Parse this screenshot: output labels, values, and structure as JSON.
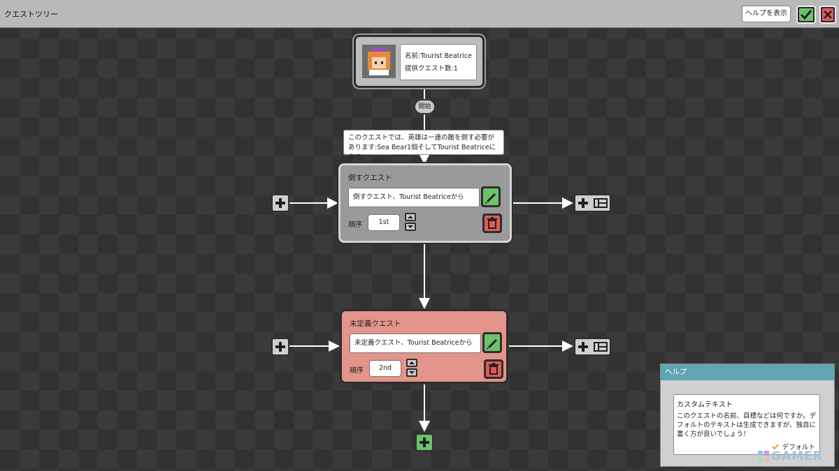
{
  "window": {
    "title": "クエストツリー"
  },
  "toolbar": {
    "help_label": "ヘルプを表示"
  },
  "giver": {
    "name_line": "名前:Tourist Beatrice",
    "count_line": "提供クエスト数:1"
  },
  "start_label": "開始",
  "description": "このクエストでは、英雄は一連の敵を倒す必要があります:Sea Bear1個そしてTourist Beatriceに戻る。",
  "quests": [
    {
      "title": "倒すクエスト",
      "name_value": "倒すクエスト、Tourist Beatriceから",
      "order_label": "順序",
      "order_value": "1st",
      "state": "selected",
      "color": "#9a9a9a"
    },
    {
      "title": "未定義クエスト",
      "name_value": "未定義クエスト、Tourist Beatriceから",
      "order_label": "順序",
      "order_value": "2nd",
      "state": "undefined",
      "color": "#e3948b"
    }
  ],
  "help_panel": {
    "header": "ヘルプ",
    "title": "カスタムテキスト",
    "text": "このクエストの名前、目標などは何ですか。デフォルトのテキストは生成できますが、独自に書く方が良いでしょう！",
    "default_label": "デフォルト"
  },
  "watermark": "GAMER",
  "colors": {
    "accent_green": "#6ac36a",
    "accent_red": "#e05a5a",
    "help_header": "#5fa6b3"
  },
  "icons": [
    "check-icon",
    "close-icon",
    "pencil-icon",
    "trash-icon",
    "plus-icon",
    "link-icon",
    "arrow-up-icon",
    "arrow-down-icon"
  ]
}
